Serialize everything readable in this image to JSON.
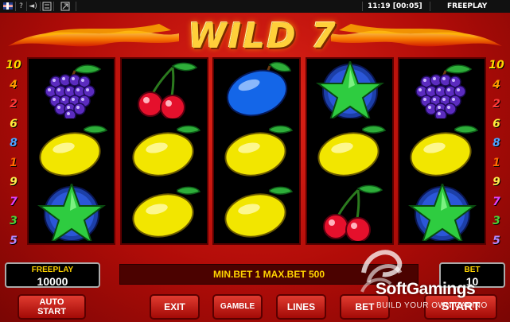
{
  "topbar": {
    "help": "?",
    "sound": "◄)",
    "clock": "11:19 [00:05]",
    "mode": "FREEPLAY"
  },
  "game": {
    "title": "WILD 7"
  },
  "paylines": {
    "left": [
      "10",
      "4",
      "2",
      "6",
      "8",
      "1",
      "9",
      "7",
      "3",
      "5"
    ],
    "right": [
      "10",
      "4",
      "2",
      "6",
      "8",
      "1",
      "9",
      "7",
      "3",
      "5"
    ],
    "colors": [
      "#ffd600",
      "#ff9a00",
      "#ff3b3b",
      "#ffeb3b",
      "#4da3ff",
      "#ff6a00",
      "#ffe94a",
      "#e040fb",
      "#4cd137",
      "#b388ff"
    ]
  },
  "reels": [
    [
      "grapes",
      "lemon",
      "star"
    ],
    [
      "cherries",
      "lemon",
      "lemon"
    ],
    [
      "plum",
      "lemon",
      "lemon"
    ],
    [
      "star",
      "lemon",
      "cherries"
    ],
    [
      "grapes",
      "lemon",
      "star"
    ]
  ],
  "panels": {
    "freeplay_label": "FREEPLAY",
    "freeplay_value": "10000",
    "bet_label": "BET",
    "bet_value": "10"
  },
  "bet_info": "MIN.BET 1 MAX.BET 500",
  "buttons": {
    "autostart_line1": "AUTO",
    "autostart_line2": "START",
    "exit": "EXIT",
    "gamble": "GAMBLE",
    "lines": "LINES",
    "bet": "BET",
    "start": "START"
  },
  "watermark": {
    "brand": "SoftGamings",
    "tagline": "BUILD YOUR OWN CASINO"
  },
  "colors": {
    "background": "#b50d0a",
    "panel_label": "#ffd400",
    "logo": "#ffcf3a"
  }
}
